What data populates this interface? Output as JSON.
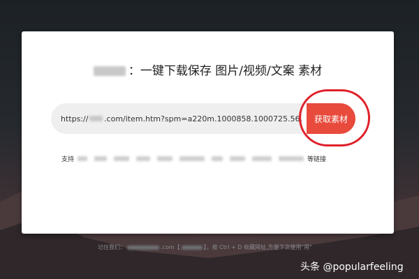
{
  "card": {
    "title_text": "：一键下载保存 图片/视频/文案 素材",
    "url_prefix": "https://",
    "url_suffix": ".com/item.htm?spm=a220m.1000858.1000725.56.",
    "button_label": "获取素材",
    "support_prefix": "支持",
    "support_suffix": "等链接"
  },
  "footer": {
    "remember_prefix": "记住我们：",
    "domain_suffix": ".com【",
    "shortcut_text": "】，按 Ctrl + D 收藏网址,方便下次使用\"用\""
  },
  "watermark": "头条 @popularfeeling",
  "colors": {
    "button": "#e84a3c",
    "highlight": "#e0202a"
  }
}
